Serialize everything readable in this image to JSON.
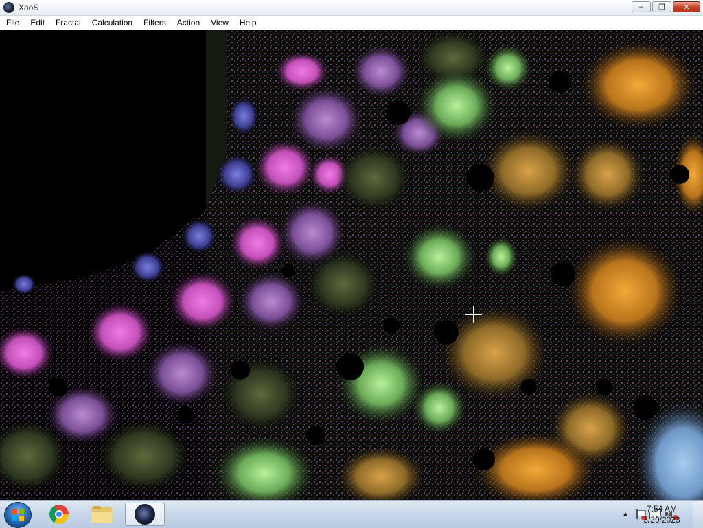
{
  "window": {
    "title": "XaoS",
    "controls": {
      "minimize": "–",
      "maximize": "❐",
      "close": "✕"
    }
  },
  "menubar": {
    "items": [
      {
        "id": "file",
        "label": "File"
      },
      {
        "id": "edit",
        "label": "Edit"
      },
      {
        "id": "fractal",
        "label": "Fractal"
      },
      {
        "id": "calculation",
        "label": "Calculation"
      },
      {
        "id": "filters",
        "label": "Filters"
      },
      {
        "id": "action",
        "label": "Action"
      },
      {
        "id": "view",
        "label": "View"
      },
      {
        "id": "help",
        "label": "Help"
      }
    ]
  },
  "canvas": {
    "palette": [
      "#000000",
      "#2a3020",
      "#5f8a4c",
      "#9fdc7e",
      "#c08ad6",
      "#e070d8",
      "#6a6ad0",
      "#8c6a2a",
      "#d89a2a",
      "#e8a030",
      "#7aa6d8"
    ],
    "cursor_icon": "crosshair-icon"
  },
  "taskbar": {
    "start_icon": "windows-start-icon",
    "pinned": [
      {
        "name": "chrome",
        "icon": "chrome-icon"
      },
      {
        "name": "file-explorer",
        "icon": "folder-icon"
      },
      {
        "name": "xaos",
        "icon": "xaos-icon",
        "active": true
      }
    ],
    "tray": {
      "overflow_glyph": "▲",
      "icons": [
        "action-center-flag-icon",
        "network-icon",
        "volume-muted-icon"
      ]
    },
    "clock": {
      "time": "7:54 AM",
      "date": "3/29/2023"
    }
  }
}
